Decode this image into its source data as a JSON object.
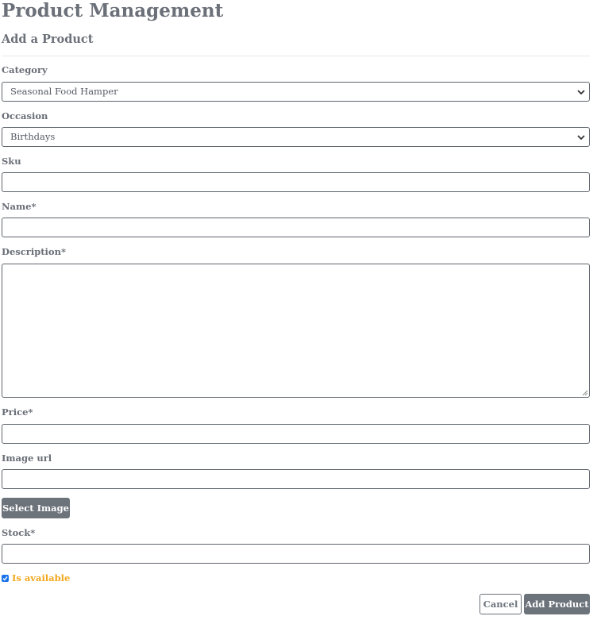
{
  "page": {
    "title": "Product Management",
    "subtitle": "Add a Product"
  },
  "form": {
    "category": {
      "label": "Category",
      "selected": "Seasonal Food Hamper"
    },
    "occasion": {
      "label": "Occasion",
      "selected": "Birthdays"
    },
    "sku": {
      "label": "Sku",
      "value": ""
    },
    "name": {
      "label": "Name*",
      "value": ""
    },
    "description": {
      "label": "Description*",
      "value": ""
    },
    "price": {
      "label": "Price*",
      "value": ""
    },
    "image_url": {
      "label": "Image url",
      "value": ""
    },
    "select_image_label": "Select Image",
    "stock": {
      "label": "Stock*",
      "value": ""
    },
    "is_available": {
      "label": "Is available",
      "checked": true
    }
  },
  "actions": {
    "cancel_label": "Cancel",
    "submit_label": "Add Product"
  },
  "colors": {
    "button": "#6c737b",
    "checkbox_label": "#f3a81d",
    "checkbox": "#1a73e8",
    "input_border": "#5f646d"
  },
  "icons": {
    "select_arrow": "chevron-down-icon",
    "checkbox": "checkmark-icon",
    "resize": "resize-grip-icon"
  }
}
